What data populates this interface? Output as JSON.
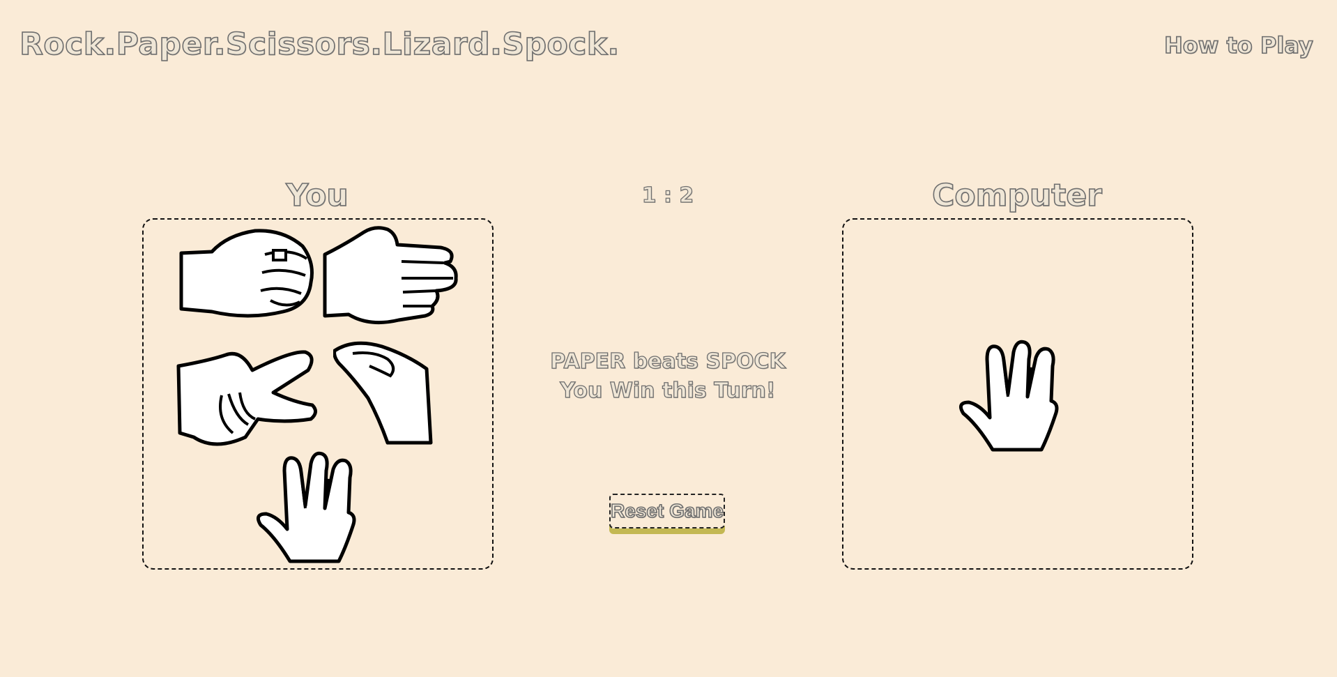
{
  "header": {
    "title": "Rock.Paper.Scissors.Lizard.Spock.",
    "how_to_play": "How to Play"
  },
  "game": {
    "player_label": "You",
    "computer_label": "Computer",
    "score": "1 : 2",
    "result_line1": "PAPER beats SPOCK",
    "result_line2": "You Win this Turn!",
    "reset_label": "Reset Game",
    "player_choices": [
      "rock-hand-icon",
      "paper-hand-icon",
      "scissors-hand-icon",
      "lizard-hand-icon",
      "spock-hand-icon"
    ],
    "computer_choice": "spock-hand-icon"
  },
  "colors": {
    "background": "#faebd7",
    "text_stroke": "#6e6e6e",
    "reset_shadow": "#c3b853",
    "panel_border": "#111111"
  }
}
